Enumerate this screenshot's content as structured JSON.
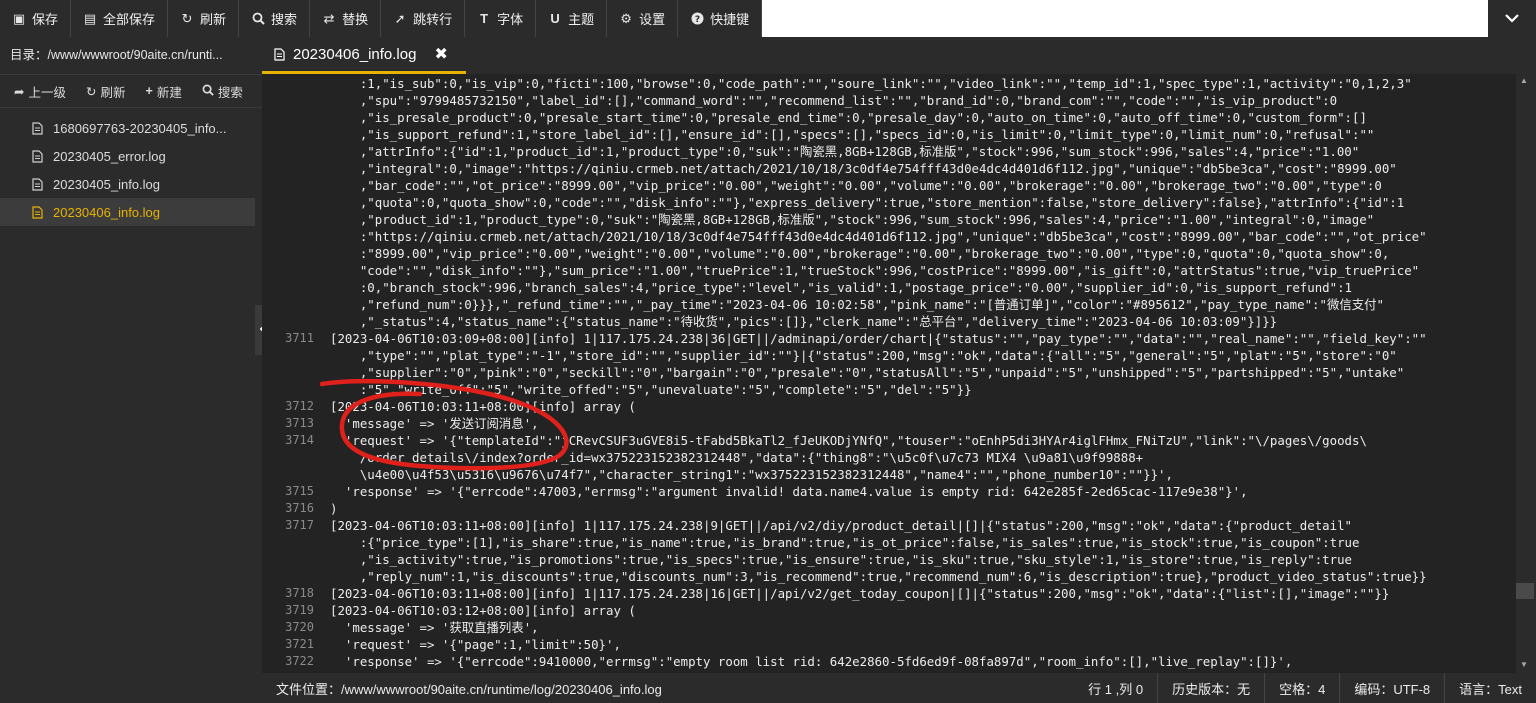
{
  "toolbar": {
    "buttons": [
      {
        "label": "保存",
        "icon": "save-icon"
      },
      {
        "label": "全部保存",
        "icon": "save-all-icon"
      },
      {
        "label": "刷新",
        "icon": "refresh-icon"
      },
      {
        "label": "搜索",
        "icon": "search-icon"
      },
      {
        "label": "替换",
        "icon": "replace-icon"
      },
      {
        "label": "跳转行",
        "icon": "goto-line-icon"
      },
      {
        "label": "字体",
        "icon": "font-icon"
      },
      {
        "label": "主题",
        "icon": "theme-icon"
      },
      {
        "label": "设置",
        "icon": "gear-icon"
      },
      {
        "label": "快捷键",
        "icon": "help-icon"
      }
    ]
  },
  "sidebar": {
    "dir_label": "目录：/www/wwwroot/90aite.cn/runti...",
    "tools": [
      {
        "label": "上一级",
        "icon": "up-level-icon"
      },
      {
        "label": "刷新",
        "icon": "refresh-icon"
      },
      {
        "label": "新建",
        "icon": "plus-icon"
      },
      {
        "label": "搜索",
        "icon": "search-icon"
      }
    ],
    "files": [
      {
        "name": "1680697763-20230405_info..."
      },
      {
        "name": "20230405_error.log"
      },
      {
        "name": "20230405_info.log"
      },
      {
        "name": "20230406_info.log"
      }
    ],
    "active_index": 3
  },
  "tab": {
    "label": "20230406_info.log",
    "close": "✖"
  },
  "colors": {
    "accent": "#e8b200",
    "annotation": "#e0201a"
  },
  "editor": {
    "lines": [
      {
        "n": "",
        "t": "    :1,\"is_sub\":0,\"is_vip\":0,\"ficti\":100,\"browse\":0,\"code_path\":\"\",\"soure_link\":\"\",\"video_link\":\"\",\"temp_id\":1,\"spec_type\":1,\"activity\":\"0,1,2,3\""
      },
      {
        "n": "",
        "t": "    ,\"spu\":\"9799485732150\",\"label_id\":[],\"command_word\":\"\",\"recommend_list\":\"\",\"brand_id\":0,\"brand_com\":\"\",\"code\":\"\",\"is_vip_product\":0"
      },
      {
        "n": "",
        "t": "    ,\"is_presale_product\":0,\"presale_start_time\":0,\"presale_end_time\":0,\"presale_day\":0,\"auto_on_time\":0,\"auto_off_time\":0,\"custom_form\":[]"
      },
      {
        "n": "",
        "t": "    ,\"is_support_refund\":1,\"store_label_id\":[],\"ensure_id\":[],\"specs\":[],\"specs_id\":0,\"is_limit\":0,\"limit_type\":0,\"limit_num\":0,\"refusal\":\"\""
      },
      {
        "n": "",
        "t": "    ,\"attrInfo\":{\"id\":1,\"product_id\":1,\"product_type\":0,\"suk\":\"陶瓷黑,8GB+128GB,标准版\",\"stock\":996,\"sum_stock\":996,\"sales\":4,\"price\":\"1.00\""
      },
      {
        "n": "",
        "t": "    ,\"integral\":0,\"image\":\"https://qiniu.crmeb.net/attach/2021/10/18/3c0df4e754fff43d0e4dc4d401d6f112.jpg\",\"unique\":\"db5be3ca\",\"cost\":\"8999.00\""
      },
      {
        "n": "",
        "t": "    ,\"bar_code\":\"\",\"ot_price\":\"8999.00\",\"vip_price\":\"0.00\",\"weight\":\"0.00\",\"volume\":\"0.00\",\"brokerage\":\"0.00\",\"brokerage_two\":\"0.00\",\"type\":0"
      },
      {
        "n": "",
        "t": "    ,\"quota\":0,\"quota_show\":0,\"code\":\"\",\"disk_info\":\"\"},\"express_delivery\":true,\"store_mention\":false,\"store_delivery\":false},\"attrInfo\":{\"id\":1"
      },
      {
        "n": "",
        "t": "    ,\"product_id\":1,\"product_type\":0,\"suk\":\"陶瓷黑,8GB+128GB,标准版\",\"stock\":996,\"sum_stock\":996,\"sales\":4,\"price\":\"1.00\",\"integral\":0,\"image\""
      },
      {
        "n": "",
        "t": "    :\"https://qiniu.crmeb.net/attach/2021/10/18/3c0df4e754fff43d0e4dc4d401d6f112.jpg\",\"unique\":\"db5be3ca\",\"cost\":\"8999.00\",\"bar_code\":\"\",\"ot_price\""
      },
      {
        "n": "",
        "t": "    :\"8999.00\",\"vip_price\":\"0.00\",\"weight\":\"0.00\",\"volume\":\"0.00\",\"brokerage\":\"0.00\",\"brokerage_two\":\"0.00\",\"type\":0,\"quota\":0,\"quota_show\":0,"
      },
      {
        "n": "",
        "t": "    \"code\":\"\",\"disk_info\":\"\"},\"sum_price\":\"1.00\",\"truePrice\":1,\"trueStock\":996,\"costPrice\":\"8999.00\",\"is_gift\":0,\"attrStatus\":true,\"vip_truePrice\""
      },
      {
        "n": "",
        "t": "    :0,\"branch_stock\":996,\"branch_sales\":4,\"price_type\":\"level\",\"is_valid\":1,\"postage_price\":\"0.00\",\"supplier_id\":0,\"is_support_refund\":1"
      },
      {
        "n": "",
        "t": "    ,\"refund_num\":0}}},\"_refund_time\":\"\",\"_pay_time\":\"2023-04-06 10:02:58\",\"pink_name\":\"[普通订单]\",\"color\":\"#895612\",\"pay_type_name\":\"微信支付\""
      },
      {
        "n": "",
        "t": "    ,\"_status\":4,\"status_name\":{\"status_name\":\"待收货\",\"pics\":[]},\"clerk_name\":\"总平台\",\"delivery_time\":\"2023-04-06 10:03:09\"}]}}"
      },
      {
        "n": "3711",
        "t": "[2023-04-06T10:03:09+08:00][info] 1|117.175.24.238|36|GET||/adminapi/order/chart|{\"status\":\"\",\"pay_type\":\"\",\"data\":\"\",\"real_name\":\"\",\"field_key\":\"\""
      },
      {
        "n": "",
        "t": "    ,\"type\":\"\",\"plat_type\":\"-1\",\"store_id\":\"\",\"supplier_id\":\"\"}|{\"status\":200,\"msg\":\"ok\",\"data\":{\"all\":\"5\",\"general\":\"5\",\"plat\":\"5\",\"store\":\"0\""
      },
      {
        "n": "",
        "t": "    ,\"supplier\":\"0\",\"pink\":\"0\",\"seckill\":\"0\",\"bargain\":\"0\",\"presale\":\"0\",\"statusAll\":\"5\",\"unpaid\":\"5\",\"unshipped\":\"5\",\"partshipped\":\"5\",\"untake\""
      },
      {
        "n": "",
        "t": "    :\"5\",\"write_off\":\"5\",\"write_offed\":\"5\",\"unevaluate\":\"5\",\"complete\":\"5\",\"del\":\"5\"}}"
      },
      {
        "n": "3712",
        "t": "[2023-04-06T10:03:11+08:00][info] array ("
      },
      {
        "n": "3713",
        "t": "  'message' => '发送订阅消息',"
      },
      {
        "n": "3714",
        "t": "  'request' => '{\"templateId\":\"jCRevCSUF3uGVE8i5-tFabd5BkaTl2_fJeUKODjYNfQ\",\"touser\":\"oEnhP5di3HYAr4iglFHmx_FNiTzU\",\"link\":\"\\/pages\\/goods\\"
      },
      {
        "n": "",
        "t": "    /order_details\\/index?order_id=wx375223152382312448\",\"data\":{\"thing8\":\"\\u5c0f\\u7c73 MIX4 \\u9a81\\u9f99888+"
      },
      {
        "n": "",
        "t": "    \\u4e00\\u4f53\\u5316\\u9676\\u74f7\",\"character_string1\":\"wx375223152382312448\",\"name4\":\"\",\"phone_number10\":\"\"}}',"
      },
      {
        "n": "3715",
        "t": "  'response' => '{\"errcode\":47003,\"errmsg\":\"argument invalid! data.name4.value is empty rid: 642e285f-2ed65cac-117e9e38\"}',"
      },
      {
        "n": "3716",
        "t": ")"
      },
      {
        "n": "3717",
        "t": "[2023-04-06T10:03:11+08:00][info] 1|117.175.24.238|9|GET||/api/v2/diy/product_detail|[]|{\"status\":200,\"msg\":\"ok\",\"data\":{\"product_detail\""
      },
      {
        "n": "",
        "t": "    :{\"price_type\":[1],\"is_share\":true,\"is_name\":true,\"is_brand\":true,\"is_ot_price\":false,\"is_sales\":true,\"is_stock\":true,\"is_coupon\":true"
      },
      {
        "n": "",
        "t": "    ,\"is_activity\":true,\"is_promotions\":true,\"is_specs\":true,\"is_ensure\":true,\"is_sku\":true,\"sku_style\":1,\"is_store\":true,\"is_reply\":true"
      },
      {
        "n": "",
        "t": "    ,\"reply_num\":1,\"is_discounts\":true,\"discounts_num\":3,\"is_recommend\":true,\"recommend_num\":6,\"is_description\":true},\"product_video_status\":true}}"
      },
      {
        "n": "3718",
        "t": "[2023-04-06T10:03:11+08:00][info] 1|117.175.24.238|16|GET||/api/v2/get_today_coupon|[]|{\"status\":200,\"msg\":\"ok\",\"data\":{\"list\":[],\"image\":\"\"}}"
      },
      {
        "n": "3719",
        "t": "[2023-04-06T10:03:12+08:00][info] array ("
      },
      {
        "n": "3720",
        "t": "  'message' => '获取直播列表',"
      },
      {
        "n": "3721",
        "t": "  'request' => '{\"page\":1,\"limit\":50}',"
      },
      {
        "n": "3722",
        "t": "  'response' => '{\"errcode\":9410000,\"errmsg\":\"empty room list rid: 642e2860-5fd6ed9f-08fa897d\",\"room_info\":[],\"live_replay\":[]}',"
      }
    ]
  },
  "statusbar": {
    "path": "文件位置：/www/wwwroot/90aite.cn/runtime/log/20230406_info.log",
    "position": "行 1 ,列 0",
    "history": "历史版本：无",
    "indent": "空格：4",
    "encoding": "编码：UTF-8",
    "language": "语言：Text"
  }
}
